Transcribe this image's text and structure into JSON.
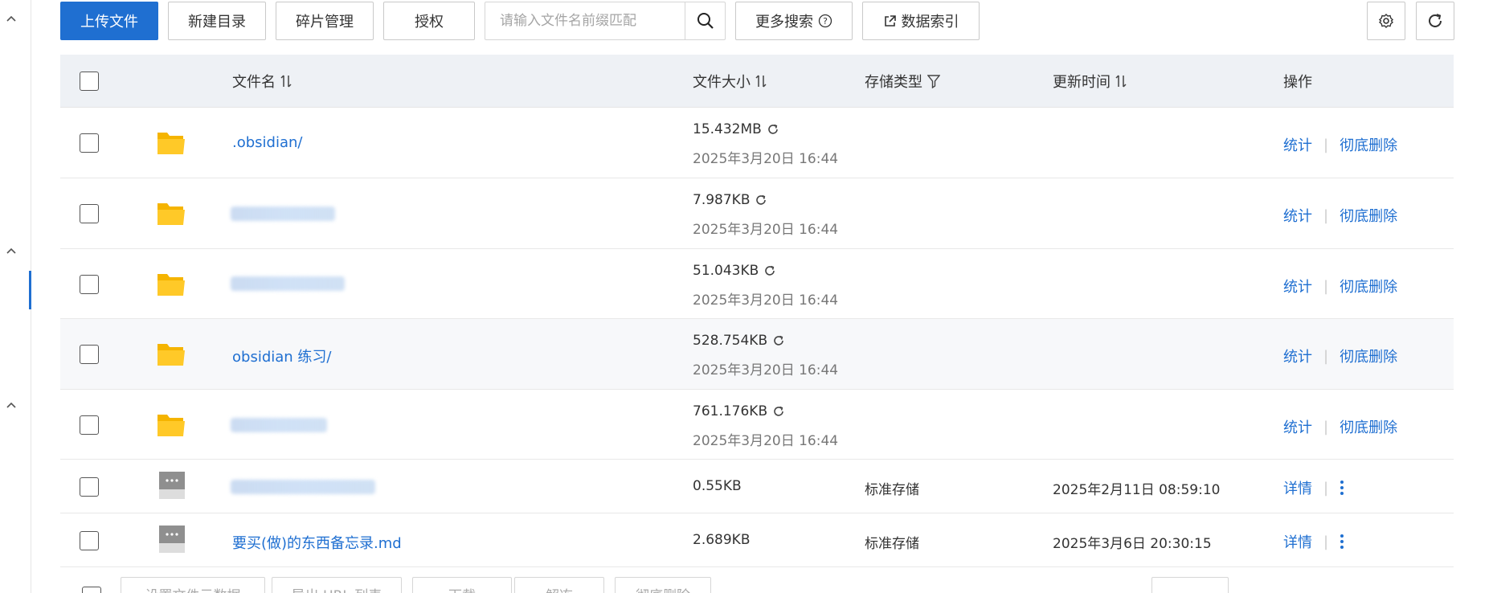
{
  "toolbar": {
    "upload": "上传文件",
    "new_dir": "新建目录",
    "fragments": "碎片管理",
    "authorize": "授权",
    "search_placeholder": "请输入文件名前缀匹配",
    "more_search": "更多搜索",
    "data_index": "数据索引"
  },
  "columns": {
    "name": "文件名",
    "size": "文件大小",
    "storage_type": "存储类型",
    "updated": "更新时间",
    "ops": "操作"
  },
  "rows": [
    {
      "name": ".obsidian/",
      "size": "15.432MB",
      "date": "2025年3月20日 16:44",
      "type": "folder",
      "ops": [
        "统计",
        "彻底删除"
      ]
    },
    {
      "name": "",
      "size": "7.987KB",
      "date": "2025年3月20日 16:44",
      "type": "folder",
      "ops": [
        "统计",
        "彻底删除"
      ]
    },
    {
      "name": "",
      "size": "51.043KB",
      "date": "2025年3月20日 16:44",
      "type": "folder",
      "ops": [
        "统计",
        "彻底删除"
      ]
    },
    {
      "name": "obsidian 练习/",
      "size": "528.754KB",
      "date": "2025年3月20日 16:44",
      "type": "folder",
      "ops": [
        "统计",
        "彻底删除"
      ]
    },
    {
      "name": "",
      "size": "761.176KB",
      "date": "2025年3月20日 16:44",
      "type": "folder",
      "ops": [
        "统计",
        "彻底删除"
      ]
    },
    {
      "name": "",
      "size": "0.55KB",
      "storage": "标准存储",
      "updated": "2025年2月11日 08:59:10",
      "type": "file",
      "ops": [
        "详情"
      ]
    },
    {
      "name": "要买(做)的东西备忘录.md",
      "size": "2.689KB",
      "storage": "标准存储",
      "updated": "2025年3月6日 20:30:15",
      "type": "file",
      "ops": [
        "详情"
      ]
    }
  ],
  "bottom": {
    "b1": "设置文件元数据",
    "b2": "导出 URL 列表",
    "b3": "下载",
    "b4": "解冻",
    "b5": "彻底删除"
  },
  "colors": {
    "accent": "#1f6fd1",
    "folder": "#ffc107"
  }
}
